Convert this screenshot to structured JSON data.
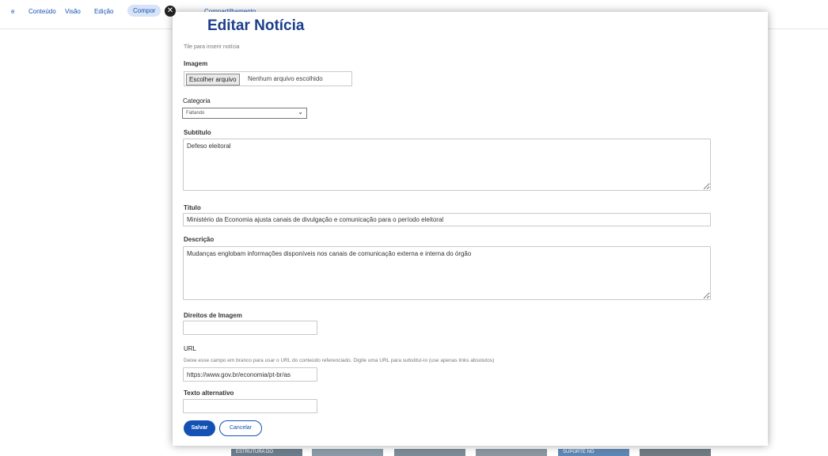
{
  "toolbar": {
    "items": [
      "Conteúdo",
      "Visão",
      "Edição",
      "Compor",
      "Compartilhamento"
    ],
    "active_index": 3,
    "brand_mark": "e"
  },
  "modal": {
    "title": "Editar Notícia",
    "subtitle_hint": "Tile para inserir notícia",
    "image_label": "Imagem",
    "file_button": "Escolher arquivo",
    "file_status": "Nenhum arquivo escolhido",
    "category_label": "Categoria",
    "category_value": "Faltando",
    "subtitle_label": "Subtítulo",
    "subtitle_value": "Defeso eleitoral",
    "titulo_label": "Título",
    "titulo_value": "Ministério da Economia ajusta canais de divulgação e comunicação para o período eleitoral",
    "description_label": "Descrição",
    "description_value": "Mudanças englobam informações disponíveis nos canais de comunicação externa e interna do órgão",
    "image_rights_label": "Direitos de Imagem",
    "image_rights_value": "",
    "url_label": "URL",
    "url_hint": "Deixe esse campo em branco para usar o URL do conteúdo referenciado. Digite uma URL para substituí-lo (use apenas links absolutos)",
    "url_value": "https://www.gov.br/economia/pt-br/as",
    "alt_text_label": "Texto alternativo",
    "alt_text_value": "",
    "save_button": "Salvar",
    "cancel_button": "Cancelar"
  },
  "background_tiles": [
    "ESTRUTURA DO",
    "SUPORTE NO"
  ],
  "colors": {
    "primary": "#1351b4",
    "title": "#1c3f8a",
    "tile": "#6b7d8c"
  }
}
